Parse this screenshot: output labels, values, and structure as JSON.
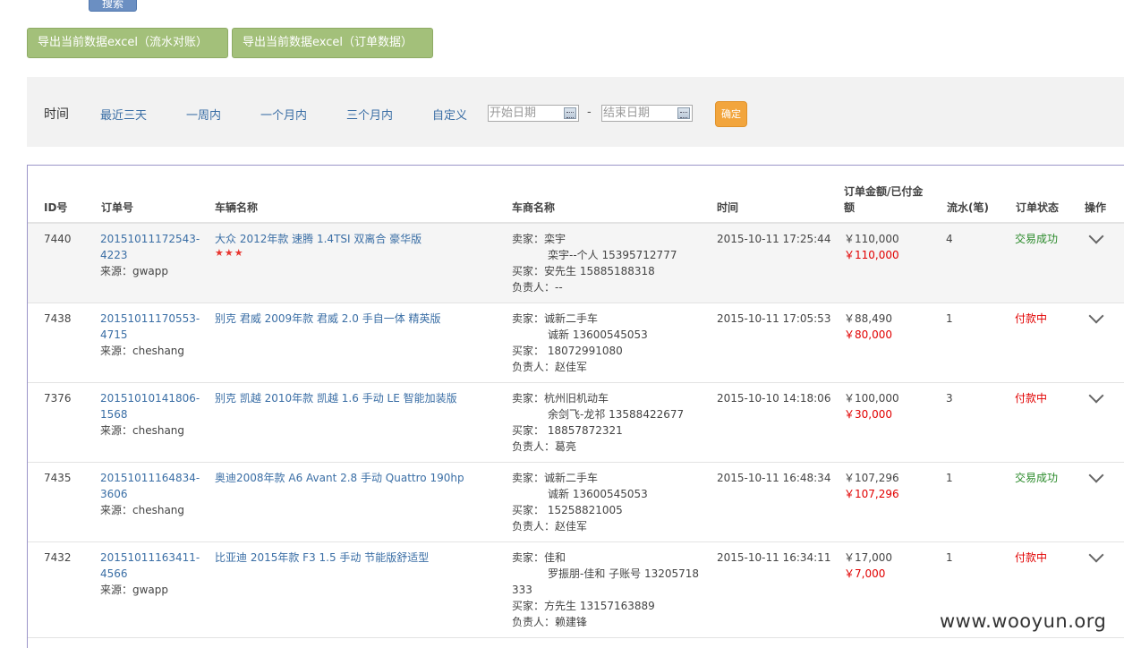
{
  "top": {
    "search_label": "搜索"
  },
  "export": {
    "flow_label": "导出当前数据excel（流水对账）",
    "order_label": "导出当前数据excel（订单数据）"
  },
  "filter": {
    "label": "时间",
    "options": [
      "最近三天",
      "一周内",
      "一个月内",
      "三个月内",
      "自定义"
    ],
    "start_placeholder": "开始日期",
    "end_placeholder": "结束日期",
    "separator": "-",
    "confirm_label": "确定"
  },
  "table": {
    "headers": {
      "id": "ID号",
      "order": "订单号",
      "vehicle": "车辆名称",
      "dealer": "车商名称",
      "time": "时间",
      "amount_line1": "订单金额/已付金",
      "amount_line2": "额",
      "flows": "流水(笔)",
      "status": "订单状态",
      "action": "操作"
    },
    "rows": [
      {
        "id": "7440",
        "order_no": "20151011172543-4223",
        "source": "来源：gwapp",
        "vehicle": "大众 2012年款 速腾 1.4TSI 双离合 豪华版",
        "stars": "★★★",
        "seller": "卖家：栾宇",
        "seller_sub": "栾宇--个人 15395712777",
        "buyer": "买家：安先生 15885188318",
        "manager": "负责人：--",
        "time": "2015-10-11 17:25:44",
        "amount": "￥110,000",
        "paid": "￥110,000",
        "flows": "4",
        "status": "交易成功"
      },
      {
        "id": "7438",
        "order_no": "20151011170553-4715",
        "source": "来源：cheshang",
        "vehicle": "别克 君威 2009年款 君威 2.0 手自一体 精英版",
        "seller": "卖家：诚新二手车",
        "seller_sub": "诚新 13600545053",
        "buyer": "买家： 18072991080",
        "manager": "负责人：赵佳军",
        "time": "2015-10-11 17:05:53",
        "amount": "￥88,490",
        "paid": "￥80,000",
        "flows": "1",
        "status": "付款中"
      },
      {
        "id": "7376",
        "order_no": "20151010141806-1568",
        "source": "来源：cheshang",
        "vehicle": "别克 凯越 2010年款 凯越 1.6 手动 LE 智能加装版",
        "seller": "卖家：杭州旧机动车",
        "seller_sub": "余剑飞-龙祁 13588422677",
        "buyer": "买家： 18857872321",
        "manager": "负责人：葛亮",
        "time": "2015-10-10 14:18:06",
        "amount": "￥100,000",
        "paid": "￥30,000",
        "flows": "3",
        "status": "付款中"
      },
      {
        "id": "7435",
        "order_no": "20151011164834-3606",
        "source": "来源：cheshang",
        "vehicle": "奥迪2008年款 A6 Avant 2.8 手动 Quattro 190hp",
        "seller": "卖家：诚新二手车",
        "seller_sub": "诚新 13600545053",
        "buyer": "买家： 15258821005",
        "manager": "负责人：赵佳军",
        "time": "2015-10-11 16:48:34",
        "amount": "￥107,296",
        "paid": "￥107,296",
        "flows": "1",
        "status": "交易成功"
      },
      {
        "id": "7432",
        "order_no": "20151011163411-4566",
        "source": "来源：gwapp",
        "vehicle": "比亚迪 2015年款 F3 1.5 手动 节能版舒适型",
        "seller": "卖家：佳和",
        "seller_sub": "罗振朋-佳和 子账号 13205718",
        "seller_sub2": "333",
        "buyer": "买家：方先生 13157163889",
        "manager": "负责人：赖建锋",
        "time": "2015-10-11 16:34:11",
        "amount": "￥17,000",
        "paid": "￥7,000",
        "flows": "1",
        "status": "付款中"
      }
    ]
  },
  "watermark": "www.wooyun.org",
  "colors": {
    "export_btn": "#a3c07a",
    "confirm_btn": "#f2a53d",
    "link": "#3a6ea5",
    "paid_red": "#e10000",
    "success_green": "#2a8a2a"
  }
}
